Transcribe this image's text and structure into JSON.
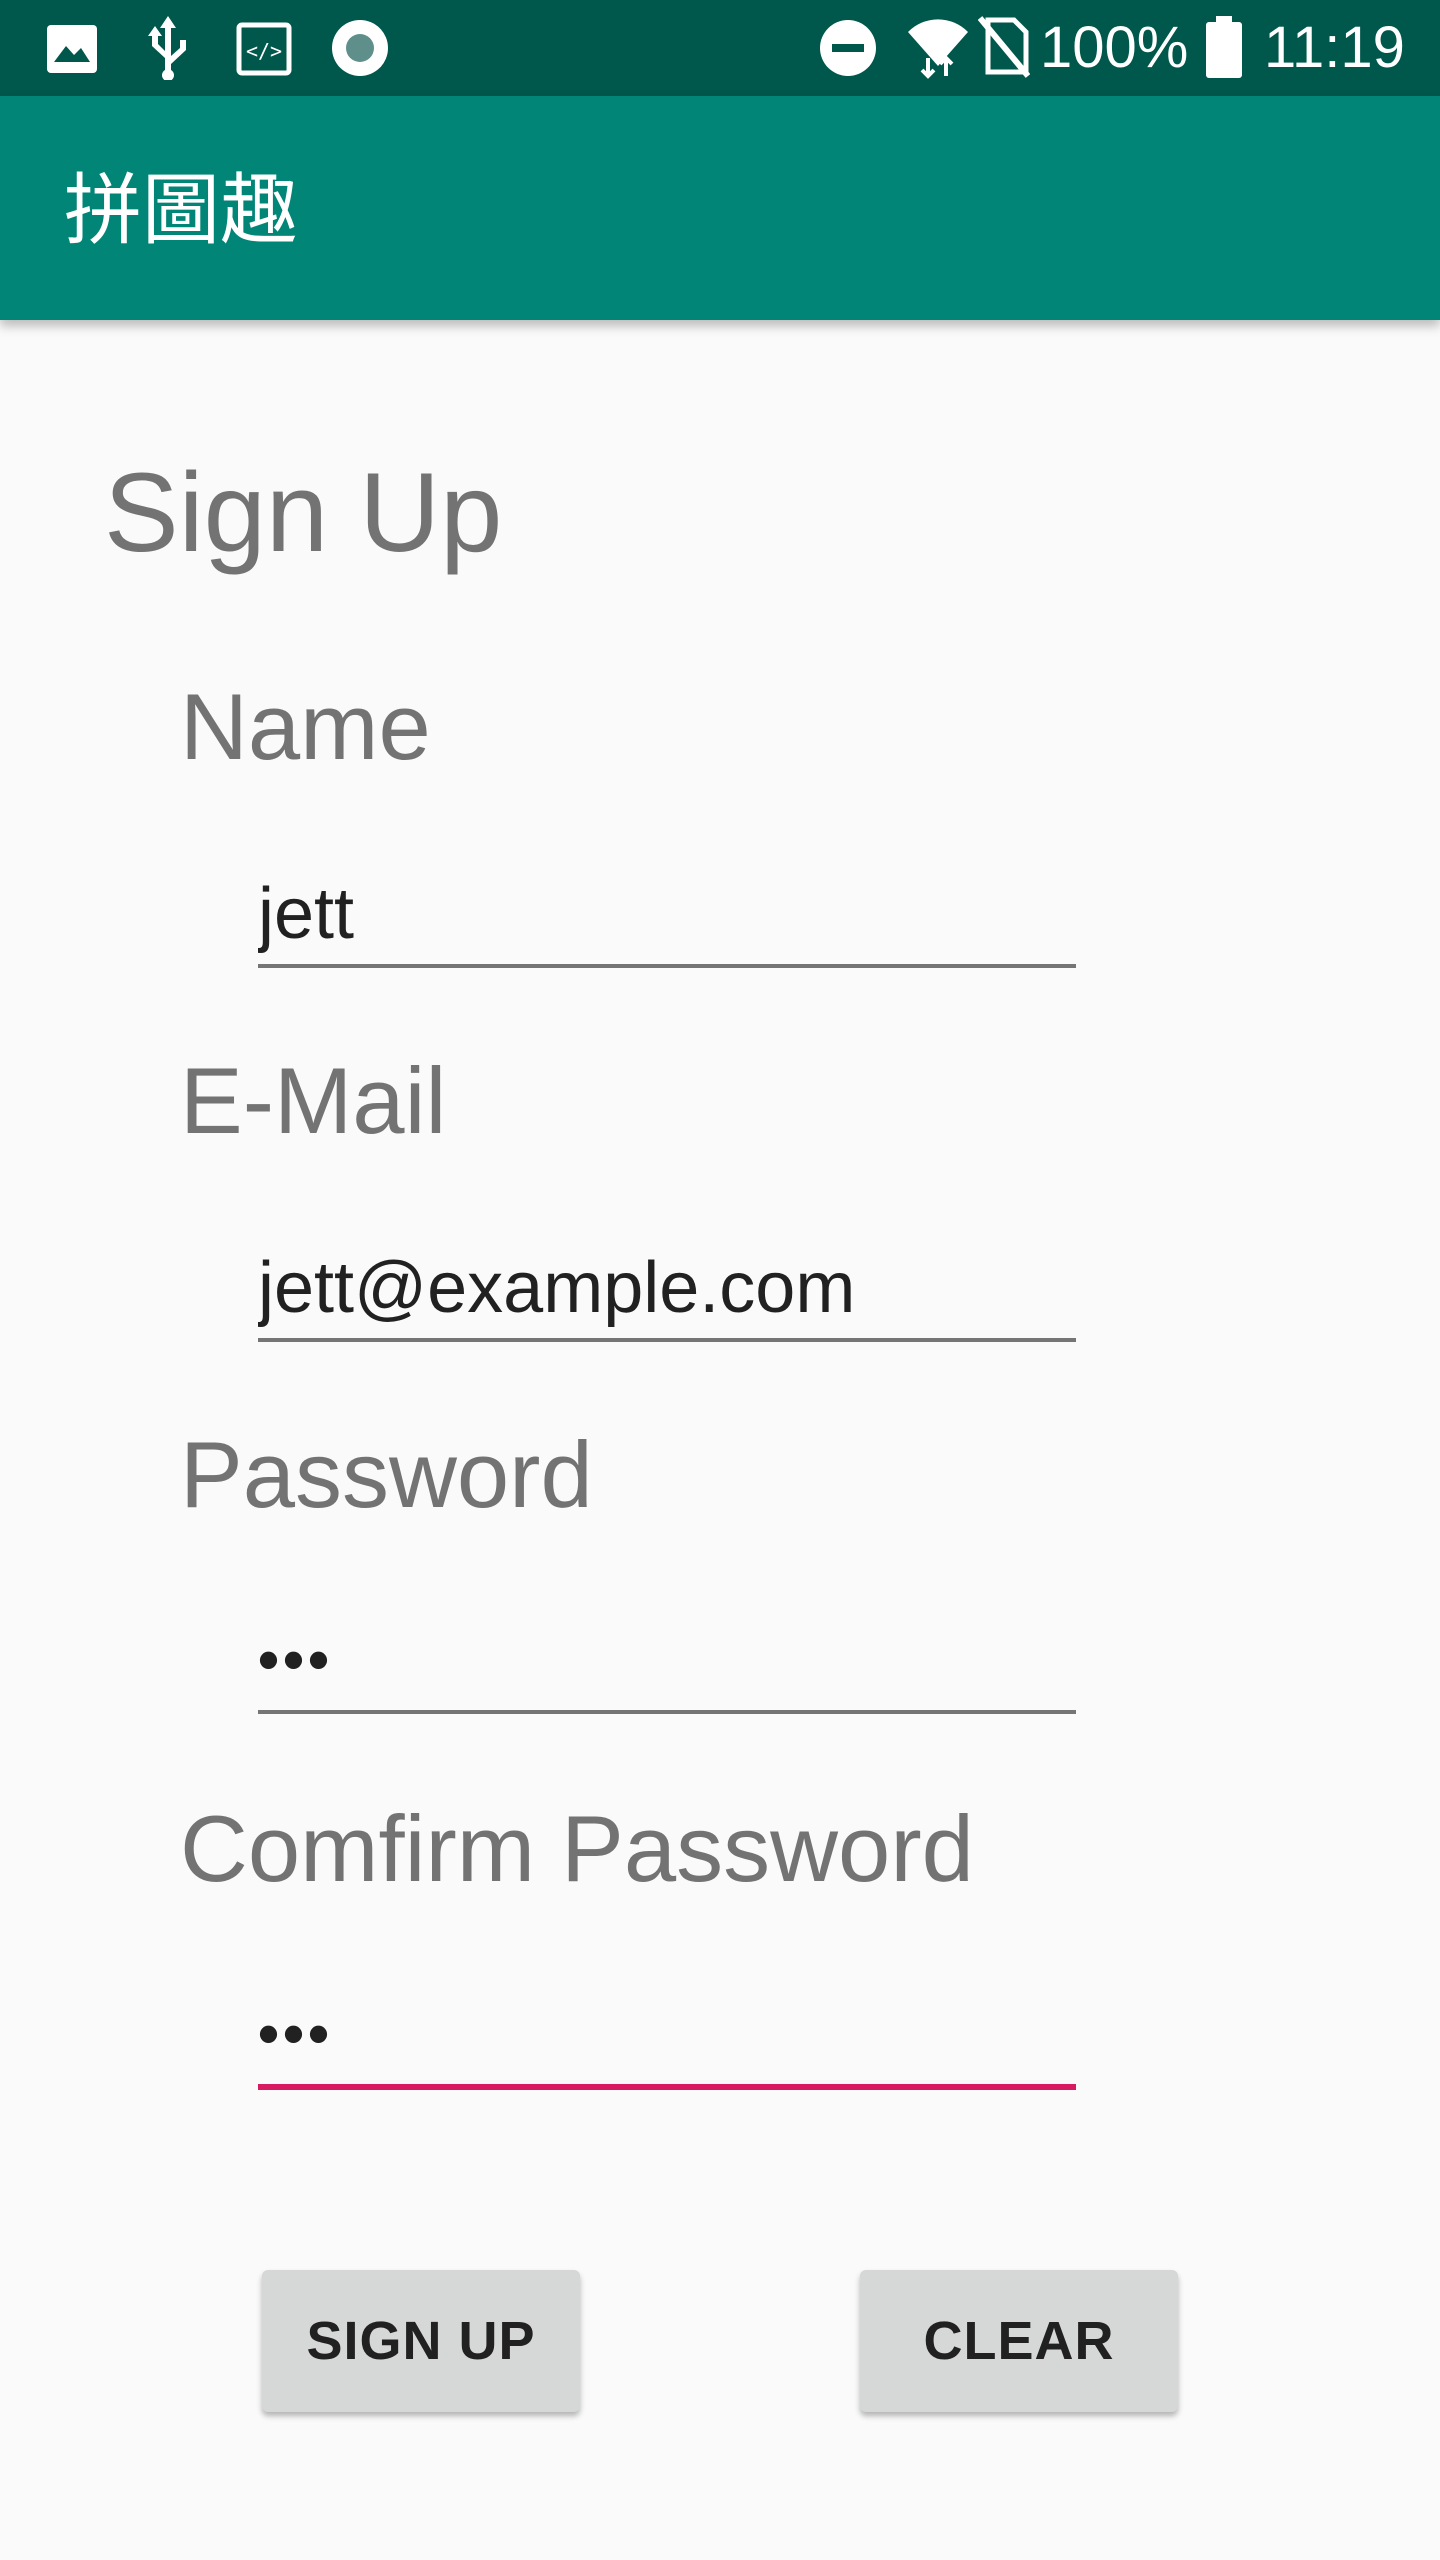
{
  "status_bar": {
    "left_icons": [
      "image-icon",
      "usb-icon",
      "code-icon",
      "record-icon"
    ],
    "right_icons": [
      "do-not-disturb-icon",
      "wifi-icon",
      "no-sim-icon",
      "battery-icon"
    ],
    "battery": "100%",
    "time": "11:19"
  },
  "app_bar": {
    "title": "拼圖趣"
  },
  "form": {
    "heading": "Sign Up",
    "name_label": "Name",
    "name_value": "jett",
    "email_label": "E-Mail",
    "email_value": "jett@example.com",
    "password_label": "Password",
    "password_value": "•••",
    "confirm_label": "Comfirm Password",
    "confirm_value": "•••"
  },
  "buttons": {
    "signup": "SIGN UP",
    "clear": "CLEAR"
  },
  "colors": {
    "status_bar": "#00574b",
    "app_bar": "#008577",
    "accent": "#d81b60",
    "background": "#fafafa"
  }
}
